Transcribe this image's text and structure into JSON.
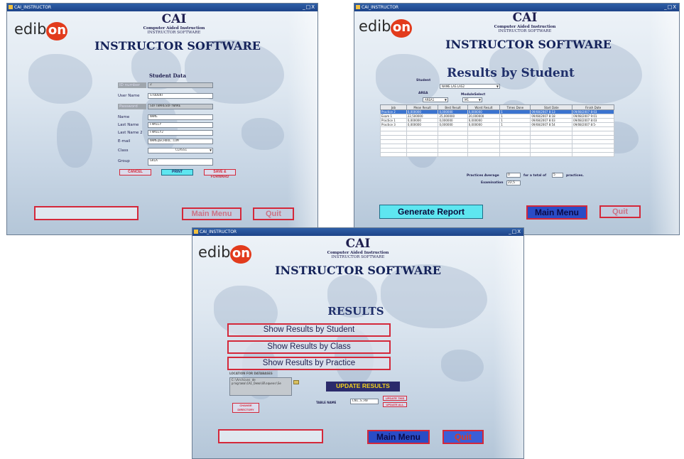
{
  "common": {
    "window_title": "CAI_INSTRUCTOR",
    "window_controls": "_□X",
    "logo": "edibon",
    "cai": "CAI",
    "subtitle_1": "Computer Aided Instruction",
    "subtitle_2": "INSTRUCTOR SOFTWARE",
    "heading": "INSTRUCTOR SOFTWARE",
    "main_menu": "Main Menu",
    "quit": "Quit"
  },
  "student_window": {
    "form_title": "Student Data",
    "fields": [
      {
        "label": "ID number",
        "value": "2",
        "disabled": true
      },
      {
        "label": "User Name",
        "value": "STUDENT",
        "disabled": false
      },
      {
        "label": "Password",
        "value": "SOFTWARESOFTWARE",
        "disabled": true
      },
      {
        "label": "Name",
        "value": "NAME",
        "disabled": false
      },
      {
        "label": "Last Name",
        "value": "FAMILY",
        "disabled": false
      },
      {
        "label": "Last Name 2",
        "value": "FAMILY2",
        "disabled": false
      },
      {
        "label": "E-mail",
        "value": "NAME@SCHOOL.COM",
        "disabled": false
      },
      {
        "label": "Class",
        "value": "CLASS1",
        "disabled": false
      },
      {
        "label": "Group",
        "value": "GR1A",
        "disabled": false
      }
    ],
    "buttons": {
      "cancel": "CANCEL",
      "print": "PRINT",
      "save": "SAVE & FORWARD"
    }
  },
  "results_student_window": {
    "title": "Results by Student",
    "student_label": "Student",
    "student_value": "NAME LAS LAS2",
    "area_label": "AREA",
    "area_value": "AREA1",
    "module_label": "ModuleSelect",
    "module_value": "M1",
    "columns": [
      "Job",
      "Mean Result",
      "Best Result",
      "Worst Result",
      "Times Done",
      "Start Date",
      "Finish Date"
    ],
    "rows": [
      [
        "Practice 2",
        "0,000000",
        "0,000000",
        "0,000000",
        "1",
        "09/08/2007 8:13",
        "09/08/2007 8:03"
      ],
      [
        "Exam 1",
        "22,500000",
        "25,000000",
        "20,000000",
        "1",
        "09/08/2007 8:18",
        "09/08/2007 9:01"
      ],
      [
        "Practice 1",
        "0,000000",
        "0,000000",
        "0,000000",
        "1",
        "09/08/2007 8:03",
        "09/08/2007 8:03"
      ],
      [
        "Practice 3",
        "0,000000",
        "0,000000",
        "0,000000",
        "1",
        "09/08/2007 8:54",
        "09/08/2007 8:5-"
      ]
    ],
    "selected_row": 0,
    "practices_average_label": "Practices Average",
    "practices_average_value": "0",
    "total_label_1": "for a total of",
    "total_value": "5",
    "total_label_2": "practices.",
    "examination_label": "Examination",
    "examination_value": "22,5",
    "generate_report": "Generate Report"
  },
  "results_window": {
    "title": "RESULTS",
    "menu": [
      "Show Results by Student",
      "Show Results by Class",
      "Show Results by Practice"
    ],
    "location_label": "LOCATION FOR DATABASES",
    "location_path": "C:\\Archivos de programa\\CAI_Demo\\Bloqueos\\Se",
    "change_directory": "CHANGE DIRECTORY",
    "update_results": "UPDATE RESULTS",
    "table_name_label": "TABLE NAME",
    "table_name_value": "LN1_S_R0",
    "update_this": "UPDATE THIS",
    "update_all": "UPDATE ALL"
  },
  "colors": {
    "accent_red": "#d4283a",
    "button_blue": "#2a4cc6",
    "cyan": "#5ee6f0",
    "titlebar": "#1d4388",
    "update_yellow": "#f3d21d"
  }
}
